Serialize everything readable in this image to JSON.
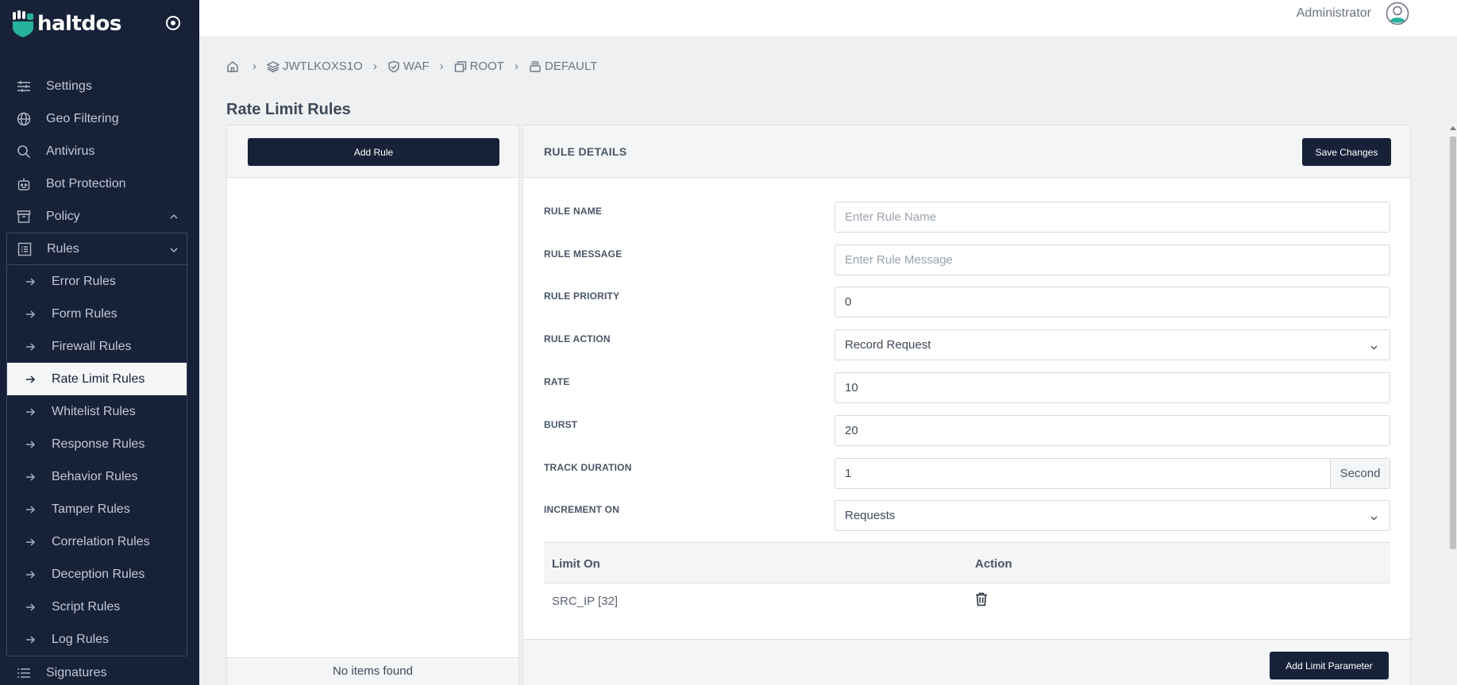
{
  "brand": {
    "name": "haltdos"
  },
  "sidebar": {
    "items": [
      {
        "label": "Settings",
        "icon": "sliders-icon"
      },
      {
        "label": "Geo Filtering",
        "icon": "globe-icon"
      },
      {
        "label": "Antivirus",
        "icon": "search-icon"
      },
      {
        "label": "Bot Protection",
        "icon": "robot-icon"
      },
      {
        "label": "Policy",
        "icon": "archive-icon"
      }
    ],
    "rules": {
      "label": "Rules",
      "icon": "list-icon",
      "children": [
        "Error Rules",
        "Form Rules",
        "Firewall Rules",
        "Rate Limit Rules",
        "Whitelist Rules",
        "Response Rules",
        "Behavior Rules",
        "Tamper Rules",
        "Correlation Rules",
        "Deception Rules",
        "Script Rules",
        "Log Rules"
      ],
      "active": "Rate Limit Rules"
    },
    "after": {
      "label": "Signatures",
      "icon": "list-lines-icon"
    }
  },
  "header": {
    "user": "Administrator"
  },
  "breadcrumb": [
    "JWTLKOXS1O",
    "WAF",
    "ROOT",
    "DEFAULT"
  ],
  "page": {
    "title": "Rate Limit Rules"
  },
  "list": {
    "add_label": "Add Rule",
    "empty_text": "No items found"
  },
  "details": {
    "title": "RULE DETAILS",
    "save_label": "Save Changes",
    "fields": {
      "rule_name": {
        "label": "RULE NAME",
        "placeholder": "Enter Rule Name",
        "value": ""
      },
      "rule_message": {
        "label": "RULE MESSAGE",
        "placeholder": "Enter Rule Message",
        "value": ""
      },
      "rule_priority": {
        "label": "RULE PRIORITY",
        "value": "0"
      },
      "rule_action": {
        "label": "RULE ACTION",
        "value": "Record Request"
      },
      "rate": {
        "label": "RATE",
        "value": "10"
      },
      "burst": {
        "label": "BURST",
        "value": "20"
      },
      "track_duration": {
        "label": "TRACK DURATION",
        "value": "1",
        "unit": "Second"
      },
      "increment_on": {
        "label": "INCREMENT ON",
        "value": "Requests"
      }
    },
    "limit_table": {
      "headers": [
        "Limit On",
        "Action"
      ],
      "rows": [
        {
          "limit_on": "SRC_IP [32]"
        }
      ]
    },
    "add_limit_label": "Add Limit Parameter"
  },
  "colors": {
    "sidebar_bg": "#172239",
    "accent": "#172239",
    "brand_green": "#27b19a"
  }
}
